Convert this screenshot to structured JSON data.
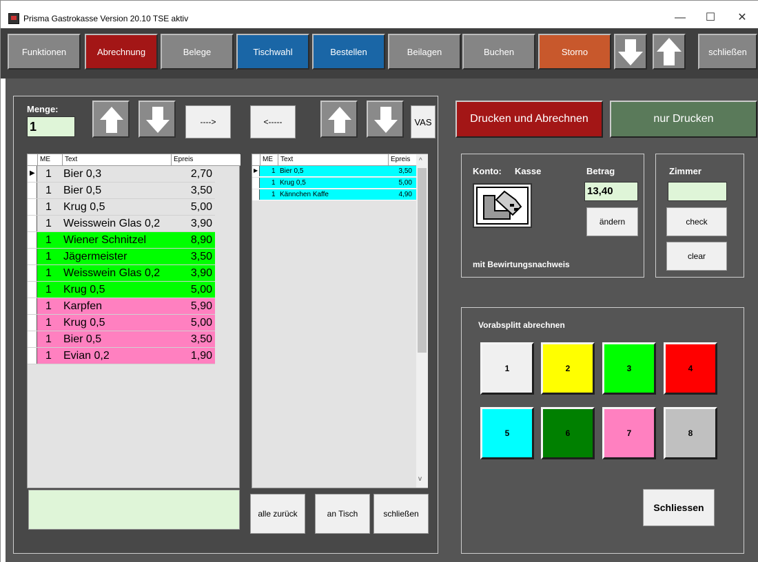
{
  "window": {
    "title": "Prisma Gastrokasse Version 20.10 TSE aktiv",
    "minimize": "—",
    "maximize": "☐",
    "close": "✕"
  },
  "toolbar": {
    "funktionen": "Funktionen",
    "abrechnung": "Abrechnung",
    "belege": "Belege",
    "tischwahl": "Tischwahl",
    "bestellen": "Bestellen",
    "beilagen": "Beilagen",
    "buchen": "Buchen",
    "storno": "Storno",
    "schliessen": "schließen"
  },
  "left": {
    "menge_label": "Menge:",
    "menge_value": "1",
    "move_right": "---->",
    "move_left": "<-----",
    "vas": "VAS",
    "headers": {
      "me": "ME",
      "text": "Text",
      "price": "Epreis"
    },
    "rows": [
      {
        "me": "1",
        "text": "Bier 0,3",
        "price": "2,70",
        "color": "#e3e3e3"
      },
      {
        "me": "1",
        "text": "Bier 0,5",
        "price": "3,50",
        "color": "#e3e3e3"
      },
      {
        "me": "1",
        "text": "Krug 0,5",
        "price": "5,00",
        "color": "#e3e3e3"
      },
      {
        "me": "1",
        "text": "Weisswein Glas 0,2",
        "price": "3,90",
        "color": "#e3e3e3"
      },
      {
        "me": "1",
        "text": "Wiener Schnitzel",
        "price": "8,90",
        "color": "#00ff00"
      },
      {
        "me": "1",
        "text": "Jägermeister",
        "price": "3,50",
        "color": "#00ff00"
      },
      {
        "me": "1",
        "text": "Weisswein Glas 0,2",
        "price": "3,90",
        "color": "#00ff00"
      },
      {
        "me": "1",
        "text": "Krug 0,5",
        "price": "5,00",
        "color": "#00ff00"
      },
      {
        "me": "1",
        "text": "Karpfen",
        "price": "5,90",
        "color": "#ff80c0"
      },
      {
        "me": "1",
        "text": "Krug 0,5",
        "price": "5,00",
        "color": "#ff80c0"
      },
      {
        "me": "1",
        "text": "Bier 0,5",
        "price": "3,50",
        "color": "#ff80c0"
      },
      {
        "me": "1",
        "text": "Evian 0,2",
        "price": "1,90",
        "color": "#ff80c0"
      }
    ],
    "split_rows": [
      {
        "me": "1",
        "text": "Bier 0,5",
        "price": "3,50"
      },
      {
        "me": "1",
        "text": "Krug 0,5",
        "price": "5,00"
      },
      {
        "me": "1",
        "text": "Kännchen Kaffe",
        "price": "4,90"
      }
    ],
    "alle_zurueck": "alle zurück",
    "an_tisch": "an Tisch",
    "schliessen": "schließen"
  },
  "right": {
    "drucken_abrechnen": "Drucken und Abrechnen",
    "nur_drucken": "nur Drucken",
    "konto_label": "Konto:",
    "konto_value": "Kasse",
    "betrag_label": "Betrag",
    "betrag_value": "13,40",
    "aendern": "ändern",
    "bewirtung": "mit Bewirtungsnachweis",
    "zimmer_label": "Zimmer",
    "zimmer_value": "",
    "check": "check",
    "clear": "clear",
    "vorab_label": "Vorabsplitt abrechnen",
    "splits": [
      {
        "label": "1",
        "color": "#f0f0f0"
      },
      {
        "label": "2",
        "color": "#ffff00"
      },
      {
        "label": "3",
        "color": "#00ff00"
      },
      {
        "label": "4",
        "color": "#ff0000"
      },
      {
        "label": "5",
        "color": "#00ffff"
      },
      {
        "label": "6",
        "color": "#008000"
      },
      {
        "label": "7",
        "color": "#ff80c0"
      },
      {
        "label": "8",
        "color": "#c0c0c0"
      }
    ],
    "schliessen": "Schliessen"
  }
}
